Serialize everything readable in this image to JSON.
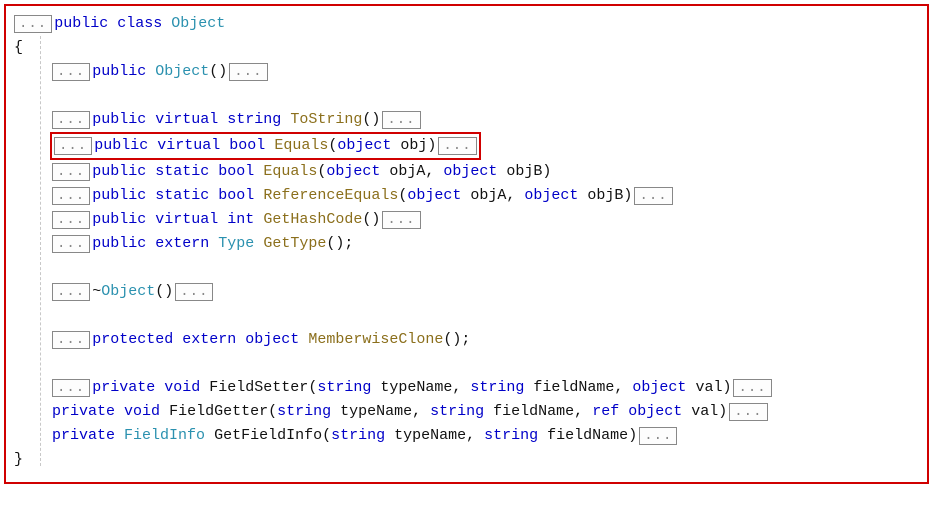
{
  "fold_glyph": "...",
  "header": {
    "kw_public": "public",
    "kw_class": "class",
    "class_name": "Object",
    "open_brace": "{",
    "close_brace": "}"
  },
  "lines": {
    "ctor": {
      "kw_public": "public",
      "name": "Object",
      "parens": "()"
    },
    "tostring": {
      "kw_public": "public",
      "kw_virtual": "virtual",
      "ret": "string",
      "name": "ToString",
      "params": "()"
    },
    "equals_virtual": {
      "kw_public": "public",
      "kw_virtual": "virtual",
      "ret": "bool",
      "name": "Equals",
      "params_open": "(",
      "p1_t": "object",
      "p1_n": " obj",
      "params_close": ")"
    },
    "equals_static": {
      "kw_public": "public",
      "kw_static": "static",
      "ret": "bool",
      "name": "Equals",
      "params_open": "(",
      "p1_t": "object",
      "p1_n": " objA, ",
      "p2_t": "object",
      "p2_n": " objB",
      "params_close": ")"
    },
    "refequals": {
      "kw_public": "public",
      "kw_static": "static",
      "ret": "bool",
      "name": "ReferenceEquals",
      "params_open": "(",
      "p1_t": "object",
      "p1_n": " objA, ",
      "p2_t": "object",
      "p2_n": " objB",
      "params_close": ")"
    },
    "gethash": {
      "kw_public": "public",
      "kw_virtual": "virtual",
      "ret": "int",
      "name": "GetHashCode",
      "params": "()"
    },
    "gettype": {
      "kw_public": "public",
      "kw_extern": "extern",
      "ret_type": "Type",
      "name": "GetType",
      "params": "();"
    },
    "dtor": {
      "tilde": "~",
      "name": "Object",
      "parens": "()"
    },
    "memberwise": {
      "kw_protected": "protected",
      "kw_extern": "extern",
      "ret": "object",
      "name": "MemberwiseClone",
      "params": "();"
    },
    "fieldsetter": {
      "kw_private": "private",
      "ret": "void",
      "name": "FieldSetter",
      "params_open": "(",
      "p1_t": "string",
      "p1_n": " typeName, ",
      "p2_t": "string",
      "p2_n": " fieldName, ",
      "p3_t": "object",
      "p3_n": " val",
      "params_close": ")"
    },
    "fieldgetter": {
      "kw_private": "private",
      "ret": "void",
      "name": "FieldGetter",
      "params_open": "(",
      "p1_t": "string",
      "p1_n": " typeName, ",
      "p2_t": "string",
      "p2_n": " fieldName, ",
      "p3_t": "ref",
      "p3_n": " ",
      "p4_t": "object",
      "p4_n": " val",
      "params_close": ")"
    },
    "getfieldinfo": {
      "kw_private": "private",
      "ret_type": "FieldInfo",
      "name": "GetFieldInfo",
      "params_open": "(",
      "p1_t": "string",
      "p1_n": " typeName, ",
      "p2_t": "string",
      "p2_n": " fieldName",
      "params_close": ")"
    }
  }
}
